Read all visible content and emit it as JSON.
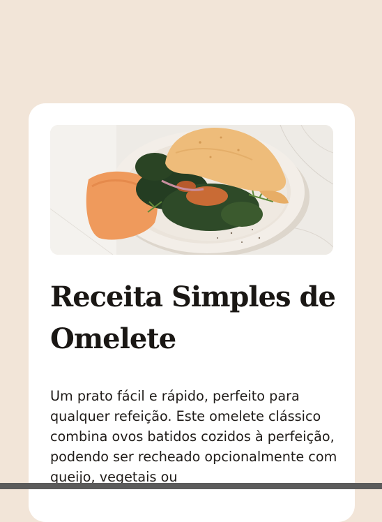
{
  "recipe": {
    "title": "Receita Simples de Omelete",
    "description": "Um prato fácil e rápido, perfeito para qualquer refeição. Este omelete clássico combina ovos batidos cozidos à perfeição, podendo ser recheado opcionalmente com queijo, vegetais ou"
  },
  "colors": {
    "page_background": "#f2e5d8",
    "card_background": "#ffffff",
    "title_text": "#1a1714",
    "body_text": "#1f1b18"
  }
}
